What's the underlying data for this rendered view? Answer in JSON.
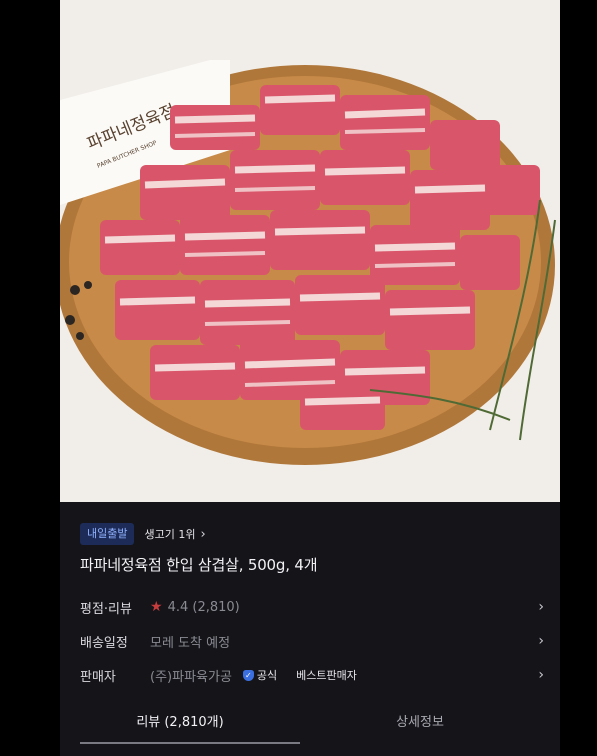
{
  "product": {
    "image_alt": "파파네정육점 한입 삼겹살",
    "brand_logo_text": "파파네정육점",
    "brand_logo_sub": "PAPA BUTCHER SHOP",
    "badge": "내일출발",
    "rank": "생고기 1위",
    "title": "파파네정육점 한입 삼겹살, 500g, 4개"
  },
  "rows": {
    "rating": {
      "label": "평점·리뷰",
      "value": "4.4 (2,810)"
    },
    "shipping": {
      "label": "배송일정",
      "value": "모레 도착 예정"
    },
    "seller": {
      "label": "판매자",
      "value": "(주)파파육가공",
      "official": "공식",
      "best": "베스트판매자"
    }
  },
  "tabs": {
    "review": "리뷰 (2,810개)",
    "details": "상세정보"
  },
  "icons": {
    "star": "star-icon",
    "chevron": "chevron-right-icon",
    "official": "shield-check-icon"
  },
  "colors": {
    "badge_bg": "#1c2b57",
    "badge_text": "#8fb1ff",
    "star": "#c63c3c",
    "official": "#3b6fe0"
  }
}
